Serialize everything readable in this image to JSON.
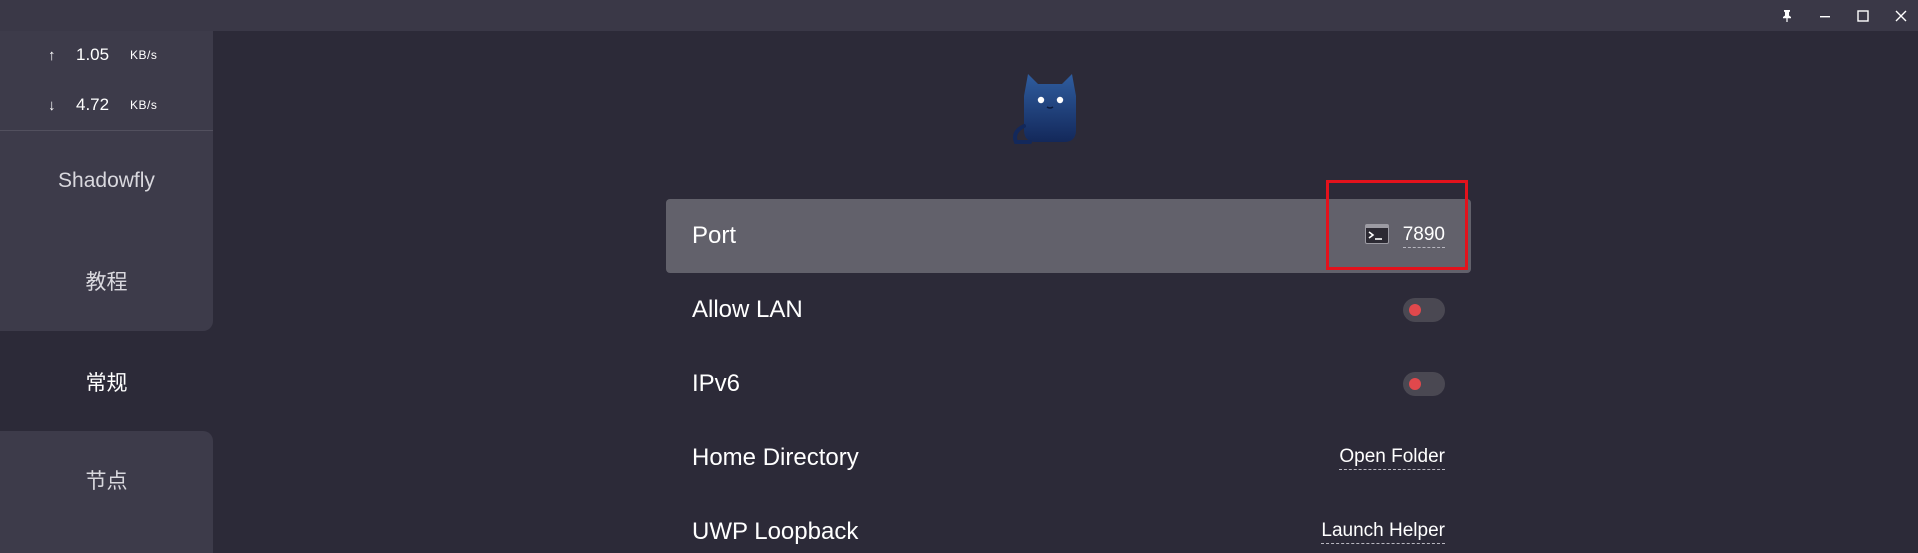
{
  "titlebar": {
    "pin_icon": "pin-icon",
    "minimize_icon": "minimize-icon",
    "maximize_icon": "maximize-icon",
    "close_icon": "close-icon"
  },
  "sidebar": {
    "traffic": {
      "upload": {
        "arrow": "↑",
        "value": "1.05",
        "unit": "KB/s"
      },
      "download": {
        "arrow": "↓",
        "value": "4.72",
        "unit": "KB/s"
      }
    },
    "items": [
      {
        "label": "Shadowfly"
      },
      {
        "label": "教程"
      },
      {
        "label": "常规",
        "active": true
      },
      {
        "label": "节点"
      }
    ]
  },
  "main": {
    "logo_icon": "clash-cat-logo",
    "settings": {
      "port": {
        "label": "Port",
        "value": "7890",
        "icon": "terminal-icon"
      },
      "allow_lan": {
        "label": "Allow LAN",
        "state": "off"
      },
      "ipv6": {
        "label": "IPv6",
        "state": "off"
      },
      "home_directory": {
        "label": "Home Directory",
        "action": "Open Folder"
      },
      "uwp_loopback": {
        "label": "UWP Loopback",
        "action": "Launch Helper"
      }
    }
  },
  "colors": {
    "background": "#2c2a38",
    "sidebar_panel": "#3d3b4a",
    "row_highlight": "#62616b",
    "toggle_knob_off": "#e0484c",
    "annotation_box": "#e3121c"
  }
}
